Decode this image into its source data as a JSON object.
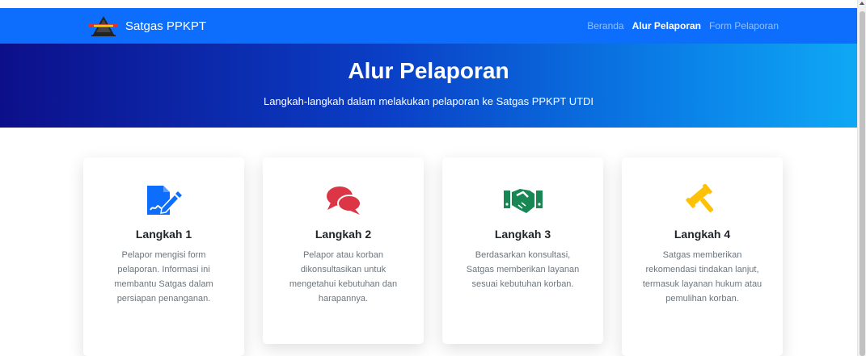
{
  "navbar": {
    "brand": "Satgas PPKPT",
    "links": [
      {
        "label": "Beranda",
        "active": false
      },
      {
        "label": "Alur Pelaporan",
        "active": true
      },
      {
        "label": "Form Pelaporan",
        "active": false
      }
    ]
  },
  "hero": {
    "title": "Alur Pelaporan",
    "subtitle": "Langkah-langkah dalam melakukan pelaporan ke Satgas PPKPT UTDI"
  },
  "steps": [
    {
      "title": "Langkah 1",
      "text": "Pelapor mengisi form pelaporan. Informasi ini membantu Satgas dalam persiapan penanganan.",
      "icon": "file-signature-icon",
      "icon_color": "#0d6efd"
    },
    {
      "title": "Langkah 2",
      "text": "Pelapor atau korban dikonsultasikan untuk mengetahui kebutuhan dan harapannya.",
      "icon": "comments-icon",
      "icon_color": "#dc3545"
    },
    {
      "title": "Langkah 3",
      "text": "Berdasarkan konsultasi, Satgas memberikan layanan sesuai kebutuhan korban.",
      "icon": "handshake-icon",
      "icon_color": "#198754"
    },
    {
      "title": "Langkah 4",
      "text": "Satgas memberikan rekomendasi tindakan lanjut, termasuk layanan hukum atau pemulihan korban.",
      "icon": "gavel-icon",
      "icon_color": "#ffc107"
    }
  ]
}
